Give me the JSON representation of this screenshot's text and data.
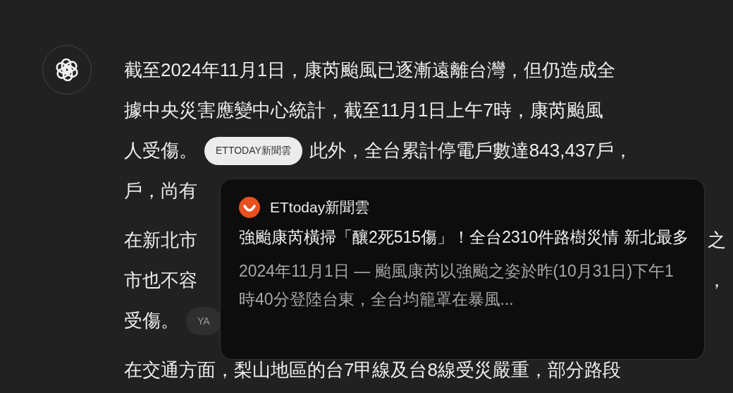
{
  "paragraphs": [
    {
      "lines": [
        {
          "segments": [
            {
              "kind": "text",
              "text": "截至2024年11月1日，康芮颱風已逐漸遠離台灣，但仍造成全"
            }
          ]
        },
        {
          "segments": [
            {
              "kind": "text",
              "text": "據中央災害應變中心統計，截至11月1日上午7時，康芮颱風"
            }
          ]
        },
        {
          "segments": [
            {
              "kind": "text",
              "text": "人受傷。"
            },
            {
              "kind": "chip",
              "label": "ETTODAY新聞雲",
              "hovered": true
            },
            {
              "kind": "text",
              "text": "此外，全台累計停電戶數達843,437戶，"
            }
          ]
        },
        {
          "segments": [
            {
              "kind": "text",
              "text": "戶，尚有"
            }
          ]
        }
      ]
    },
    {
      "lines": [
        {
          "segments": [
            {
              "kind": "text",
              "text": "在新北市"
            }
          ],
          "right": "之"
        },
        {
          "segments": [
            {
              "kind": "text",
              "text": "市也不容"
            }
          ],
          "right": "，"
        },
        {
          "segments": [
            {
              "kind": "text",
              "text": "受傷。"
            },
            {
              "kind": "chip",
              "label": "YA",
              "hovered": false
            }
          ]
        }
      ]
    },
    {
      "lines": [
        {
          "segments": [
            {
              "kind": "text",
              "text": "在交通方面，梨山地區的台7甲線及台8線受災嚴重，部分路段"
            }
          ]
        }
      ]
    }
  ],
  "popup": {
    "source": "ETtoday新聞雲",
    "title": "強颱康芮橫掃「釀2死515傷」！全台2310件路樹災情 新北最多",
    "snippet": "2024年11月1日 — 颱風康芮以強颱之姿於昨(10月31日)下午1時40分登陸台東，全台均籠罩在暴風..."
  }
}
